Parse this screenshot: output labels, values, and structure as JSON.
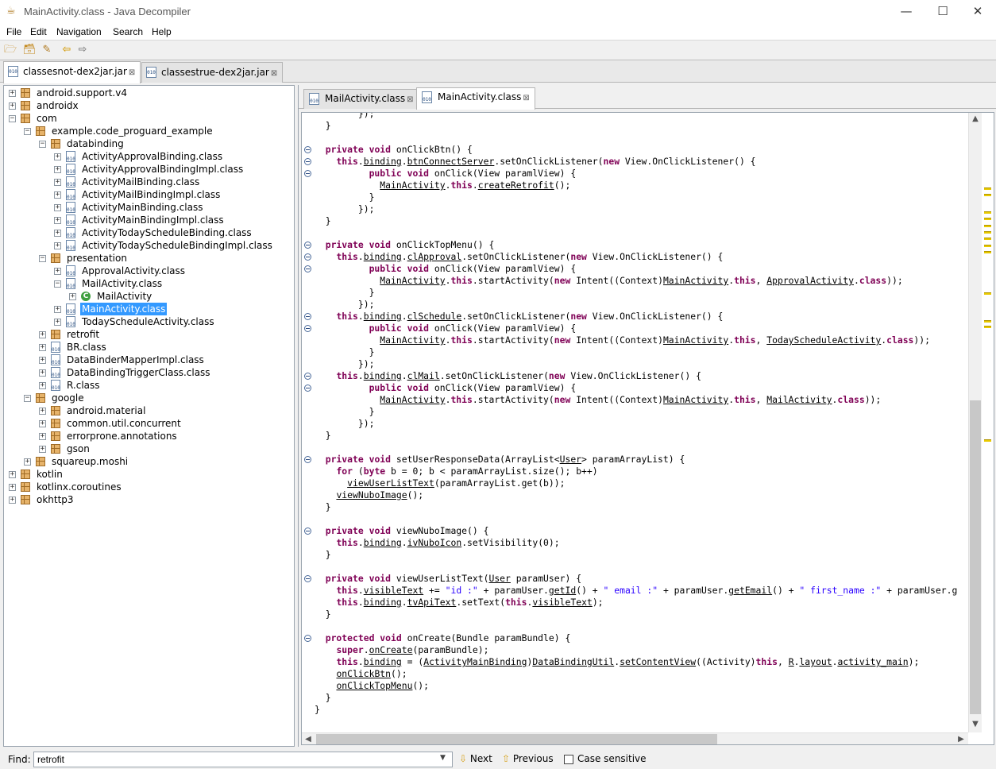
{
  "window": {
    "title": "MainActivity.class - Java Decompiler",
    "minimize": "—",
    "maximize": "☐",
    "close": "✕"
  },
  "menu": [
    "File",
    "Edit",
    "Navigation",
    "Search",
    "Help"
  ],
  "jar_tabs": [
    {
      "label": "classesnot-dex2jar.jar",
      "active": true
    },
    {
      "label": "classestrue-dex2jar.jar",
      "active": false
    }
  ],
  "tree": [
    {
      "label": "android.support.v4",
      "level": 0,
      "type": "package",
      "toggle": "+"
    },
    {
      "label": "androidx",
      "level": 0,
      "type": "package",
      "toggle": "+"
    },
    {
      "label": "com",
      "level": 0,
      "type": "package",
      "toggle": "-"
    },
    {
      "label": "example.code_proguard_example",
      "level": 1,
      "type": "package",
      "toggle": "-"
    },
    {
      "label": "databinding",
      "level": 2,
      "type": "package",
      "toggle": "-"
    },
    {
      "label": "ActivityApprovalBinding.class",
      "level": 3,
      "type": "class",
      "toggle": "+"
    },
    {
      "label": "ActivityApprovalBindingImpl.class",
      "level": 3,
      "type": "class",
      "toggle": "+"
    },
    {
      "label": "ActivityMailBinding.class",
      "level": 3,
      "type": "class",
      "toggle": "+"
    },
    {
      "label": "ActivityMailBindingImpl.class",
      "level": 3,
      "type": "class",
      "toggle": "+"
    },
    {
      "label": "ActivityMainBinding.class",
      "level": 3,
      "type": "class",
      "toggle": "+"
    },
    {
      "label": "ActivityMainBindingImpl.class",
      "level": 3,
      "type": "class",
      "toggle": "+"
    },
    {
      "label": "ActivityTodayScheduleBinding.class",
      "level": 3,
      "type": "class",
      "toggle": "+"
    },
    {
      "label": "ActivityTodayScheduleBindingImpl.class",
      "level": 3,
      "type": "class",
      "toggle": "+"
    },
    {
      "label": "presentation",
      "level": 2,
      "type": "package",
      "toggle": "-"
    },
    {
      "label": "ApprovalActivity.class",
      "level": 3,
      "type": "class",
      "toggle": "+"
    },
    {
      "label": "MailActivity.class",
      "level": 3,
      "type": "class",
      "toggle": "-"
    },
    {
      "label": "MailActivity",
      "level": 4,
      "type": "type",
      "toggle": "+"
    },
    {
      "label": "MainActivity.class",
      "level": 3,
      "type": "class",
      "toggle": "+",
      "selected": true
    },
    {
      "label": "TodayScheduleActivity.class",
      "level": 3,
      "type": "class",
      "toggle": "+"
    },
    {
      "label": "retrofit",
      "level": 2,
      "type": "package",
      "toggle": "+"
    },
    {
      "label": "BR.class",
      "level": 2,
      "type": "class",
      "toggle": "+"
    },
    {
      "label": "DataBinderMapperImpl.class",
      "level": 2,
      "type": "class",
      "toggle": "+"
    },
    {
      "label": "DataBindingTriggerClass.class",
      "level": 2,
      "type": "class",
      "toggle": "+"
    },
    {
      "label": "R.class",
      "level": 2,
      "type": "class",
      "toggle": "+"
    },
    {
      "label": "google",
      "level": 1,
      "type": "package",
      "toggle": "-"
    },
    {
      "label": "android.material",
      "level": 2,
      "type": "package",
      "toggle": "+"
    },
    {
      "label": "common.util.concurrent",
      "level": 2,
      "type": "package",
      "toggle": "+"
    },
    {
      "label": "errorprone.annotations",
      "level": 2,
      "type": "package",
      "toggle": "+"
    },
    {
      "label": "gson",
      "level": 2,
      "type": "package",
      "toggle": "+"
    },
    {
      "label": "squareup.moshi",
      "level": 1,
      "type": "package",
      "toggle": "+"
    },
    {
      "label": "kotlin",
      "level": 0,
      "type": "package",
      "toggle": "+"
    },
    {
      "label": "kotlinx.coroutines",
      "level": 0,
      "type": "package",
      "toggle": "+"
    },
    {
      "label": "okhttp3",
      "level": 0,
      "type": "package",
      "toggle": "+"
    }
  ],
  "class_tabs": [
    {
      "label": "MailActivity.class",
      "active": false
    },
    {
      "label": "MainActivity.class",
      "active": true
    }
  ],
  "code_lines": [
    [
      {
        "t": "        });"
      }
    ],
    [
      {
        "t": "  }"
      }
    ],
    [
      {
        "t": ""
      }
    ],
    [
      {
        "t": "  "
      },
      {
        "t": "private void",
        "c": "k"
      },
      {
        "t": " onClickBtn() {"
      }
    ],
    [
      {
        "t": "    "
      },
      {
        "t": "this",
        "c": "k"
      },
      {
        "t": "."
      },
      {
        "t": "binding",
        "c": "u"
      },
      {
        "t": "."
      },
      {
        "t": "btnConnectServer",
        "c": "u"
      },
      {
        "t": ".setOnClickListener("
      },
      {
        "t": "new",
        "c": "k"
      },
      {
        "t": " View.OnClickListener() {"
      }
    ],
    [
      {
        "t": "          "
      },
      {
        "t": "public void",
        "c": "k"
      },
      {
        "t": " onClick(View paramlView) {"
      }
    ],
    [
      {
        "t": "            "
      },
      {
        "t": "MainActivity",
        "c": "u"
      },
      {
        "t": "."
      },
      {
        "t": "this",
        "c": "k"
      },
      {
        "t": "."
      },
      {
        "t": "createRetrofit",
        "c": "u"
      },
      {
        "t": "();"
      }
    ],
    [
      {
        "t": "          }"
      }
    ],
    [
      {
        "t": "        });"
      }
    ],
    [
      {
        "t": "  }"
      }
    ],
    [
      {
        "t": ""
      }
    ],
    [
      {
        "t": "  "
      },
      {
        "t": "private void",
        "c": "k"
      },
      {
        "t": " onClickTopMenu() {"
      }
    ],
    [
      {
        "t": "    "
      },
      {
        "t": "this",
        "c": "k"
      },
      {
        "t": "."
      },
      {
        "t": "binding",
        "c": "u"
      },
      {
        "t": "."
      },
      {
        "t": "clApproval",
        "c": "u"
      },
      {
        "t": ".setOnClickListener("
      },
      {
        "t": "new",
        "c": "k"
      },
      {
        "t": " View.OnClickListener() {"
      }
    ],
    [
      {
        "t": "          "
      },
      {
        "t": "public void",
        "c": "k"
      },
      {
        "t": " onClick(View paramlView) {"
      }
    ],
    [
      {
        "t": "            "
      },
      {
        "t": "MainActivity",
        "c": "u"
      },
      {
        "t": "."
      },
      {
        "t": "this",
        "c": "k"
      },
      {
        "t": ".startActivity("
      },
      {
        "t": "new",
        "c": "k"
      },
      {
        "t": " Intent((Context)"
      },
      {
        "t": "MainActivity",
        "c": "u"
      },
      {
        "t": "."
      },
      {
        "t": "this",
        "c": "k"
      },
      {
        "t": ", "
      },
      {
        "t": "ApprovalActivity",
        "c": "u"
      },
      {
        "t": "."
      },
      {
        "t": "class",
        "c": "k"
      },
      {
        "t": "));"
      }
    ],
    [
      {
        "t": "          }"
      }
    ],
    [
      {
        "t": "        });"
      }
    ],
    [
      {
        "t": "    "
      },
      {
        "t": "this",
        "c": "k"
      },
      {
        "t": "."
      },
      {
        "t": "binding",
        "c": "u"
      },
      {
        "t": "."
      },
      {
        "t": "clSchedule",
        "c": "u"
      },
      {
        "t": ".setOnClickListener("
      },
      {
        "t": "new",
        "c": "k"
      },
      {
        "t": " View.OnClickListener() {"
      }
    ],
    [
      {
        "t": "          "
      },
      {
        "t": "public void",
        "c": "k"
      },
      {
        "t": " onClick(View paramlView) {"
      }
    ],
    [
      {
        "t": "            "
      },
      {
        "t": "MainActivity",
        "c": "u"
      },
      {
        "t": "."
      },
      {
        "t": "this",
        "c": "k"
      },
      {
        "t": ".startActivity("
      },
      {
        "t": "new",
        "c": "k"
      },
      {
        "t": " Intent((Context)"
      },
      {
        "t": "MainActivity",
        "c": "u"
      },
      {
        "t": "."
      },
      {
        "t": "this",
        "c": "k"
      },
      {
        "t": ", "
      },
      {
        "t": "TodayScheduleActivity",
        "c": "u"
      },
      {
        "t": "."
      },
      {
        "t": "class",
        "c": "k"
      },
      {
        "t": "));"
      }
    ],
    [
      {
        "t": "          }"
      }
    ],
    [
      {
        "t": "        });"
      }
    ],
    [
      {
        "t": "    "
      },
      {
        "t": "this",
        "c": "k"
      },
      {
        "t": "."
      },
      {
        "t": "binding",
        "c": "u"
      },
      {
        "t": "."
      },
      {
        "t": "clMail",
        "c": "u"
      },
      {
        "t": ".setOnClickListener("
      },
      {
        "t": "new",
        "c": "k"
      },
      {
        "t": " View.OnClickListener() {"
      }
    ],
    [
      {
        "t": "          "
      },
      {
        "t": "public void",
        "c": "k"
      },
      {
        "t": " onClick(View paramlView) {"
      }
    ],
    [
      {
        "t": "            "
      },
      {
        "t": "MainActivity",
        "c": "u"
      },
      {
        "t": "."
      },
      {
        "t": "this",
        "c": "k"
      },
      {
        "t": ".startActivity("
      },
      {
        "t": "new",
        "c": "k"
      },
      {
        "t": " Intent((Context)"
      },
      {
        "t": "MainActivity",
        "c": "u"
      },
      {
        "t": "."
      },
      {
        "t": "this",
        "c": "k"
      },
      {
        "t": ", "
      },
      {
        "t": "MailActivity",
        "c": "u"
      },
      {
        "t": "."
      },
      {
        "t": "class",
        "c": "k"
      },
      {
        "t": "));"
      }
    ],
    [
      {
        "t": "          }"
      }
    ],
    [
      {
        "t": "        });"
      }
    ],
    [
      {
        "t": "  }"
      }
    ],
    [
      {
        "t": ""
      }
    ],
    [
      {
        "t": "  "
      },
      {
        "t": "private void",
        "c": "k"
      },
      {
        "t": " setUserResponseData(ArrayList<"
      },
      {
        "t": "User",
        "c": "u"
      },
      {
        "t": "> paramArrayList) {"
      }
    ],
    [
      {
        "t": "    "
      },
      {
        "t": "for",
        "c": "k"
      },
      {
        "t": " ("
      },
      {
        "t": "byte",
        "c": "k"
      },
      {
        "t": " b = 0; b < paramArrayList.size(); b++)"
      }
    ],
    [
      {
        "t": "      "
      },
      {
        "t": "viewUserListText",
        "c": "u"
      },
      {
        "t": "(paramArrayList.get(b));"
      }
    ],
    [
      {
        "t": "    "
      },
      {
        "t": "viewNuboImage",
        "c": "u"
      },
      {
        "t": "();"
      }
    ],
    [
      {
        "t": "  }"
      }
    ],
    [
      {
        "t": ""
      }
    ],
    [
      {
        "t": "  "
      },
      {
        "t": "private void",
        "c": "k"
      },
      {
        "t": " viewNuboImage() {"
      }
    ],
    [
      {
        "t": "    "
      },
      {
        "t": "this",
        "c": "k"
      },
      {
        "t": "."
      },
      {
        "t": "binding",
        "c": "u"
      },
      {
        "t": "."
      },
      {
        "t": "ivNuboIcon",
        "c": "u"
      },
      {
        "t": ".setVisibility(0);"
      }
    ],
    [
      {
        "t": "  }"
      }
    ],
    [
      {
        "t": ""
      }
    ],
    [
      {
        "t": "  "
      },
      {
        "t": "private void",
        "c": "k"
      },
      {
        "t": " viewUserListText("
      },
      {
        "t": "User",
        "c": "u"
      },
      {
        "t": " paramUser) {"
      }
    ],
    [
      {
        "t": "    "
      },
      {
        "t": "this",
        "c": "k"
      },
      {
        "t": "."
      },
      {
        "t": "visibleText",
        "c": "u"
      },
      {
        "t": " += "
      },
      {
        "t": "\"id :\"",
        "c": "s"
      },
      {
        "t": " + paramUser."
      },
      {
        "t": "getId",
        "c": "u"
      },
      {
        "t": "() + "
      },
      {
        "t": "\" email :\"",
        "c": "s"
      },
      {
        "t": " + paramUser."
      },
      {
        "t": "getEmail",
        "c": "u"
      },
      {
        "t": "() + "
      },
      {
        "t": "\" first_name :\"",
        "c": "s"
      },
      {
        "t": " + paramUser.g"
      }
    ],
    [
      {
        "t": "    "
      },
      {
        "t": "this",
        "c": "k"
      },
      {
        "t": "."
      },
      {
        "t": "binding",
        "c": "u"
      },
      {
        "t": "."
      },
      {
        "t": "tvApiText",
        "c": "u"
      },
      {
        "t": ".setText("
      },
      {
        "t": "this",
        "c": "k"
      },
      {
        "t": "."
      },
      {
        "t": "visibleText",
        "c": "u"
      },
      {
        "t": ");"
      }
    ],
    [
      {
        "t": "  }"
      }
    ],
    [
      {
        "t": ""
      }
    ],
    [
      {
        "t": "  "
      },
      {
        "t": "protected void",
        "c": "k"
      },
      {
        "t": " onCreate(Bundle paramBundle) {"
      }
    ],
    [
      {
        "t": "    "
      },
      {
        "t": "super",
        "c": "k"
      },
      {
        "t": "."
      },
      {
        "t": "onCreate",
        "c": "u"
      },
      {
        "t": "(paramBundle);"
      }
    ],
    [
      {
        "t": "    "
      },
      {
        "t": "this",
        "c": "k"
      },
      {
        "t": "."
      },
      {
        "t": "binding",
        "c": "u"
      },
      {
        "t": " = ("
      },
      {
        "t": "ActivityMainBinding",
        "c": "u"
      },
      {
        "t": ")"
      },
      {
        "t": "DataBindingUtil",
        "c": "u"
      },
      {
        "t": "."
      },
      {
        "t": "setContentView",
        "c": "u"
      },
      {
        "t": "((Activity)"
      },
      {
        "t": "this",
        "c": "k"
      },
      {
        "t": ", "
      },
      {
        "t": "R",
        "c": "u"
      },
      {
        "t": "."
      },
      {
        "t": "layout",
        "c": "u"
      },
      {
        "t": "."
      },
      {
        "t": "activity_main",
        "c": "u"
      },
      {
        "t": ");"
      }
    ],
    [
      {
        "t": "    "
      },
      {
        "t": "onClickBtn",
        "c": "u"
      },
      {
        "t": "();"
      }
    ],
    [
      {
        "t": "    "
      },
      {
        "t": "onClickTopMenu",
        "c": "u"
      },
      {
        "t": "();"
      }
    ],
    [
      {
        "t": "  }"
      }
    ],
    [
      {
        "t": "}"
      }
    ]
  ],
  "find": {
    "label": "Find:",
    "value": "retrofit",
    "next": "Next",
    "previous": "Previous",
    "case_sensitive": "Case sensitive"
  }
}
